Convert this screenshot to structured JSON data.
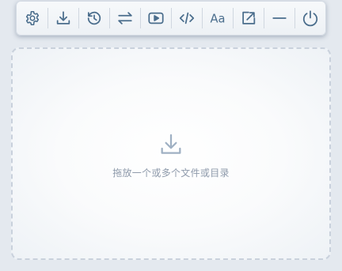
{
  "toolbar": {
    "buttons": [
      {
        "name": "settings",
        "icon": "gear-icon"
      },
      {
        "name": "download",
        "icon": "download-icon"
      },
      {
        "name": "history",
        "icon": "history-icon"
      },
      {
        "name": "swap",
        "icon": "swap-arrows-icon"
      },
      {
        "name": "play",
        "icon": "play-icon"
      },
      {
        "name": "code",
        "icon": "code-icon"
      },
      {
        "name": "font",
        "icon": "font-icon",
        "label": "Aa"
      },
      {
        "name": "share",
        "icon": "external-link-icon"
      },
      {
        "name": "minimize",
        "icon": "minimize-icon"
      },
      {
        "name": "power",
        "icon": "power-icon"
      }
    ]
  },
  "drop_zone": {
    "icon": "download-icon",
    "text": "拖放一个或多个文件或目录"
  },
  "colors": {
    "icon": "#4a6d8c",
    "background": "#e4e9ef",
    "dashed_border": "#c9d1dc",
    "hint_text": "#8e9aab"
  }
}
